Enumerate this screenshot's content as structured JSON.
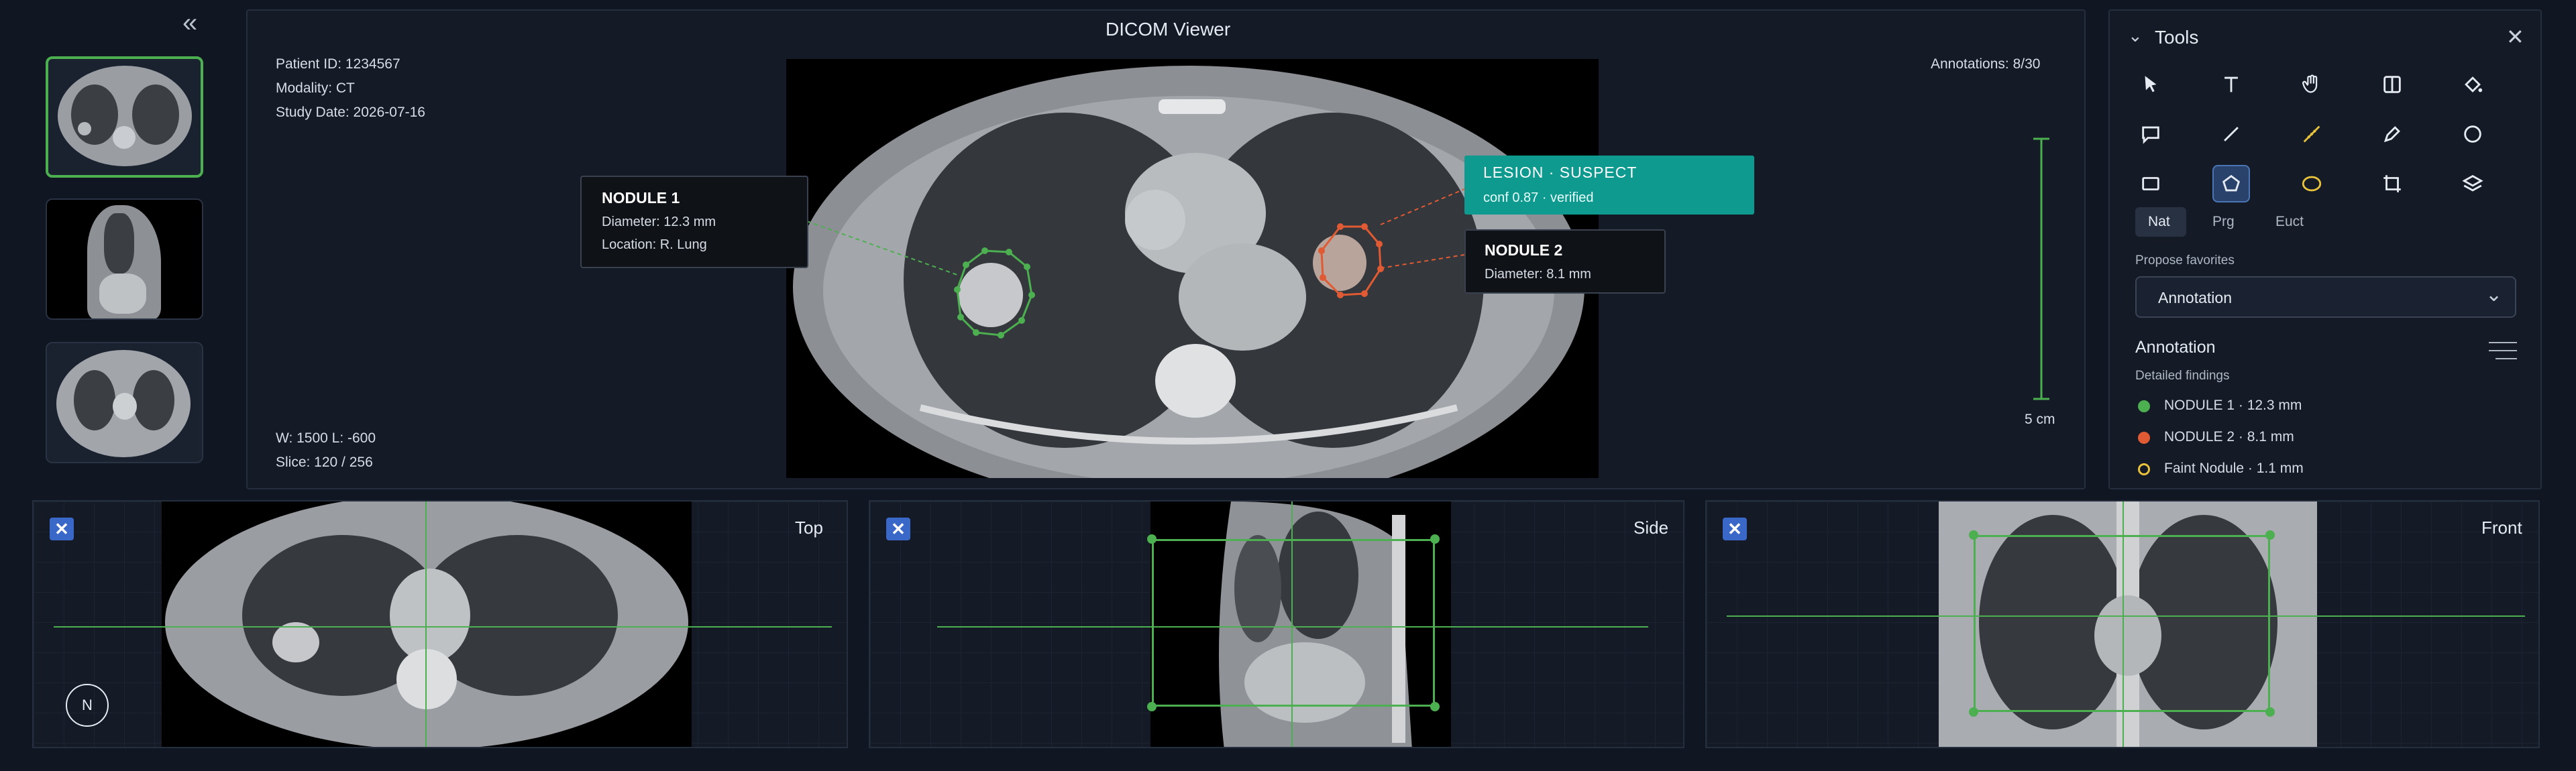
{
  "viewer": {
    "title": "DICOM Viewer"
  },
  "patient": {
    "id": "Patient ID: 1234567",
    "modality": "Modality: CT",
    "study_date": "Study Date: 2026-07-16"
  },
  "window_level": "W: 1500 L: -600",
  "slice": "Slice: 120 / 256",
  "annotations_count": "Annotations: 8/30",
  "scale_label": "5 cm",
  "callouts": {
    "nodule1": {
      "title": "NODULE 1",
      "diameter": "Diameter: 12.3 mm",
      "location": "Location: R. Lung"
    },
    "lesion": {
      "title": "LESION · SUSPECT",
      "conf": "conf 0.87 · verified"
    },
    "nodule2": {
      "title": "NODULE 2",
      "diameter": "Diameter: 8.1 mm"
    }
  },
  "tools": {
    "header": "Tools",
    "items": [
      "pointer-icon",
      "text-icon",
      "hand-icon",
      "split-view-icon",
      "fill-icon",
      "comment-icon",
      "line-icon",
      "ruler-icon",
      "pen-icon",
      "circle-icon",
      "rectangle-icon",
      "polygon-icon",
      "ellipse-icon",
      "crop-icon",
      "layers-icon"
    ],
    "selected": "polygon-icon",
    "modes": [
      "Nat",
      "Prg",
      "Euct"
    ],
    "active_mode": "Nat",
    "favorites_label": "Propose favorites",
    "dropdown_value": "Annotation",
    "section_title": "Annotation",
    "section_sub": "Detailed findings",
    "findings": [
      {
        "label": "NODULE 1 · 12.3 mm",
        "color": "#4caf50",
        "style": "filled"
      },
      {
        "label": "NODULE 2 · 8.1 mm",
        "color": "#e05a33",
        "style": "filled"
      },
      {
        "label": "Faint Nodule · 1.1 mm",
        "color": "#e8c23a",
        "style": "ring"
      }
    ]
  },
  "viewports": {
    "top": "Top",
    "side": "Side",
    "front": "Front",
    "orientation": "N"
  },
  "colors": {
    "accent_green": "#4caf50",
    "accent_orange": "#e05a33",
    "accent_teal": "#0f9a8f",
    "accent_blue": "#3a68c8"
  }
}
